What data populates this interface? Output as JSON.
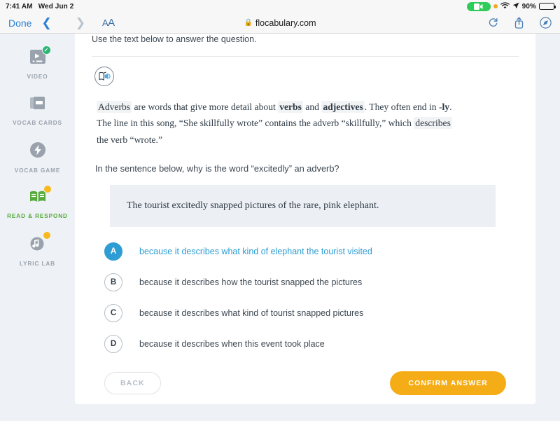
{
  "statusbar": {
    "time": "7:41 AM",
    "date": "Wed Jun 2",
    "recording_icon": "video-recording-indicator",
    "orange_dot_icon": "microphone-in-use-dot",
    "wifi_icon": "wifi-icon",
    "location_icon": "location-arrow-icon",
    "battery_percent": "90%",
    "battery_icon": "battery-icon"
  },
  "browser": {
    "done_label": "Done",
    "back_icon": "chevron-left-icon",
    "forward_icon": "chevron-right-icon",
    "text_size_label_small": "A",
    "text_size_label_large": "A",
    "lock_icon": "lock-icon",
    "url": "flocabulary.com",
    "reload_icon": "reload-icon",
    "share_icon": "share-icon",
    "safari_icon": "compass-icon"
  },
  "sidebar": {
    "items": [
      {
        "label": "VIDEO",
        "icon": "video-icon",
        "badge": "check",
        "active": false
      },
      {
        "label": "VOCAB CARDS",
        "icon": "vocab-cards-icon",
        "badge": "none",
        "active": false
      },
      {
        "label": "VOCAB GAME",
        "icon": "lightning-bolt-icon",
        "badge": "none",
        "active": false
      },
      {
        "label": "READ & RESPOND",
        "icon": "open-book-icon",
        "badge": "dot",
        "active": true
      },
      {
        "label": "LYRIC LAB",
        "icon": "music-note-icon",
        "badge": "dot",
        "active": false
      }
    ]
  },
  "lesson": {
    "instruction": "Use the text below to answer the question.",
    "read_aloud_icon": "read-aloud-icon",
    "passage": {
      "part1": "Adverbs",
      "part2": " are words that give more detail about ",
      "part3": "verbs",
      "part4": " and ",
      "part5": "adjectives",
      "part6": ". They often end in -",
      "part7": "ly",
      "part8": ". The line in this song, “She skillfully wrote” contains the adverb “skillfully,” which ",
      "part9": "describes",
      "part10": " the verb “wrote.”"
    },
    "question": "In the sentence below, why is the word “excitedly” an adverb?",
    "sentence": "The tourist excitedly snapped pictures of the rare, pink elephant.",
    "options": [
      {
        "letter": "A",
        "text": "because it describes what kind of elephant the tourist visited",
        "selected": true
      },
      {
        "letter": "B",
        "text": "because it describes how the tourist snapped the pictures",
        "selected": false
      },
      {
        "letter": "C",
        "text": "because it describes what kind of tourist snapped pictures",
        "selected": false
      },
      {
        "letter": "D",
        "text": "because it describes when this event took place",
        "selected": false
      }
    ],
    "back_label": "BACK",
    "confirm_label": "CONFIRM ANSWER"
  },
  "colors": {
    "accent_blue": "#2e9dd4",
    "accent_amber": "#f5ad17",
    "active_green": "#57ab3e",
    "badge_green": "#2bb673",
    "page_bg": "#eef1f5"
  }
}
